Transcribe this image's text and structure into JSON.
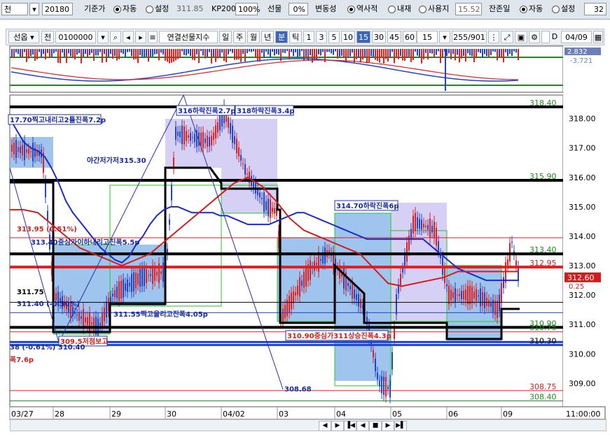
{
  "topbar": {
    "code": "천",
    "date": "20180",
    "basis_label": "기준가",
    "auto1": "자동",
    "set1": "설정",
    "basis_value": "311.85",
    "kp_label": "KP200",
    "kp_pct": "100%",
    "futures_label": "선물",
    "futures_pct": "0%",
    "vol_label": "변동성",
    "hist": "역사적",
    "implied": "내재",
    "user": "사용지",
    "vol_value": "15.52",
    "remain_label": "잔존일",
    "auto2": "자동",
    "set2": "설정",
    "remain_value": "32"
  },
  "toolbar": {
    "type_select": "선옵",
    "jeon": "전",
    "code": "0100000",
    "name": "연결선물지수",
    "periods": [
      "일",
      "주",
      "월",
      "년",
      "분",
      "틱"
    ],
    "active_period": "분",
    "intervals": [
      "1",
      "3",
      "5",
      "10",
      "15",
      "30",
      "45",
      "60"
    ],
    "active_interval": "15",
    "interval_value": "15",
    "count": "255/901",
    "d_label": "D",
    "date": "04/09"
  },
  "indicator": {
    "value1": "2.832",
    "value2": "-3.721"
  },
  "chart_data": {
    "type": "line",
    "ylim": [
      308.2,
      318.8
    ],
    "x_ticks": [
      "03/27",
      "28",
      "29",
      "30",
      "04/02",
      "03",
      "04",
      "05",
      "06",
      "09"
    ],
    "x_time_label": "11:00:00",
    "y_ticks": [
      309.0,
      310.0,
      311.0,
      312.0,
      313.0,
      314.0,
      315.0,
      316.0,
      317.0,
      318.0
    ],
    "level_labels": [
      {
        "text": "318.40",
        "value": 318.4,
        "color": "#1f8a1f"
      },
      {
        "text": "315.90",
        "value": 315.9,
        "color": "#1f8a1f"
      },
      {
        "text": "313.40",
        "value": 313.4,
        "color": "#1f8a1f"
      },
      {
        "text": "312.95",
        "value": 312.95,
        "color": "#d02020"
      },
      {
        "text": "310.90",
        "value": 310.9,
        "color": "#1f8a1f"
      },
      {
        "text": "310.75",
        "value": 310.75,
        "color": "#1f8a1f"
      },
      {
        "text": "310.30",
        "value": 310.3,
        "color": "#000000"
      },
      {
        "text": "308.75",
        "value": 308.75,
        "color": "#d02020"
      },
      {
        "text": "308.40",
        "value": 308.4,
        "color": "#1f8a1f"
      }
    ],
    "current_price": "312.60",
    "current_change": "0.25",
    "annotations": [
      {
        "text": "17.70찍고내리고2틀진폭7.2p",
        "color": "#1a2aa0"
      },
      {
        "text": "316하락진폭2.7p",
        "color": "#1a2aa0"
      },
      {
        "text": "318하락진폭3.4p",
        "color": "#1a2aa0"
      },
      {
        "text": "야간저가저315.30",
        "color": "#1a2aa0"
      },
      {
        "text": "314.70하락진폭6p",
        "color": "#1a2aa0"
      },
      {
        "text": "313.95 (0.51%)",
        "color": "#d02020"
      },
      {
        "text": "313.40중심가이하내리고진폭5.5p",
        "color": "#1a2aa0"
      },
      {
        "text": "311.75",
        "color": "#000000"
      },
      {
        "text": "311.40 (-0.30%)",
        "color": "#1a2aa0"
      },
      {
        "text": "311.55찍고올리고진폭4.05p",
        "color": "#1a2aa0"
      },
      {
        "text": "310.90중심가311상승진폭4.3p",
        "color": "#d02020"
      },
      {
        "text": "309.5저점보고",
        "color": "#d02020"
      },
      {
        "text": "308.68",
        "color": "#1a2aa0"
      },
      {
        "text": "폭7.6p",
        "color": "#d02020"
      },
      {
        "text": "38 (-0.61%) 310.40",
        "color": "#1a2aa0"
      }
    ],
    "series": [
      {
        "name": "",
        "color": "#1a2acc",
        "x": [
          0,
          10,
          20,
          30,
          40,
          50,
          60,
          70,
          80,
          90,
          100,
          110,
          120,
          130,
          140,
          150,
          160,
          170,
          180,
          190,
          200,
          210,
          220,
          230,
          240,
          250,
          260,
          270,
          280,
          290,
          300,
          310,
          320,
          330,
          340,
          350,
          360,
          370,
          380,
          390,
          400,
          410,
          420,
          430,
          440,
          450,
          460,
          470,
          480,
          490,
          500,
          510,
          520,
          530,
          540,
          550,
          560,
          570,
          580,
          590,
          600,
          610,
          620,
          630,
          640,
          650,
          660,
          670,
          680,
          690,
          700,
          710,
          720,
          727
        ],
        "values": [
          318.0,
          317.6,
          317.2,
          317.0,
          316.9,
          316.7,
          316.3,
          315.8,
          315.2,
          314.8,
          314.5,
          314.2,
          313.9,
          313.6,
          313.4,
          313.2,
          313.1,
          313.3,
          313.7,
          314.0,
          314.4,
          314.7,
          314.9,
          315.0,
          315.0,
          314.9,
          314.8,
          314.8,
          314.8,
          314.8,
          314.7,
          314.7,
          314.6,
          314.5,
          314.4,
          314.4,
          314.4,
          314.4,
          314.5,
          314.6,
          314.7,
          314.8,
          314.8,
          314.7,
          314.6,
          314.5,
          314.4,
          314.3,
          314.2,
          314.1,
          314.0,
          313.9,
          313.9,
          313.9,
          313.9,
          313.9,
          313.9,
          313.9,
          313.9,
          313.9,
          313.7,
          313.5,
          313.3,
          313.1,
          312.9,
          312.8,
          312.7,
          312.6,
          312.5,
          312.5,
          312.5,
          312.5,
          312.5,
          312.5
        ]
      },
      {
        "name": "",
        "color": "#d41c1c",
        "x": [
          0,
          20,
          40,
          60,
          80,
          100,
          120,
          140,
          160,
          180,
          200,
          220,
          240,
          260,
          280,
          300,
          320,
          340,
          360,
          380,
          400,
          420,
          440,
          460,
          480,
          500,
          520,
          540,
          560,
          580,
          600,
          620,
          640,
          660,
          680,
          700,
          720,
          727
        ],
        "values": [
          314.9,
          314.9,
          314.8,
          314.4,
          314.0,
          313.6,
          313.4,
          313.2,
          313.0,
          313.2,
          313.4,
          313.8,
          314.2,
          314.6,
          315.0,
          315.4,
          315.8,
          316.0,
          315.7,
          315.2,
          314.6,
          314.2,
          314.0,
          313.8,
          313.6,
          313.4,
          312.9,
          312.4,
          312.3,
          312.4,
          312.5,
          312.6,
          312.8,
          312.8,
          312.8,
          312.8,
          312.8,
          312.8
        ]
      }
    ]
  },
  "bottombar": {
    "controls": [
      "◀",
      "▶",
      "▐◀",
      "◀",
      "■",
      "▶",
      "▶▌"
    ]
  }
}
